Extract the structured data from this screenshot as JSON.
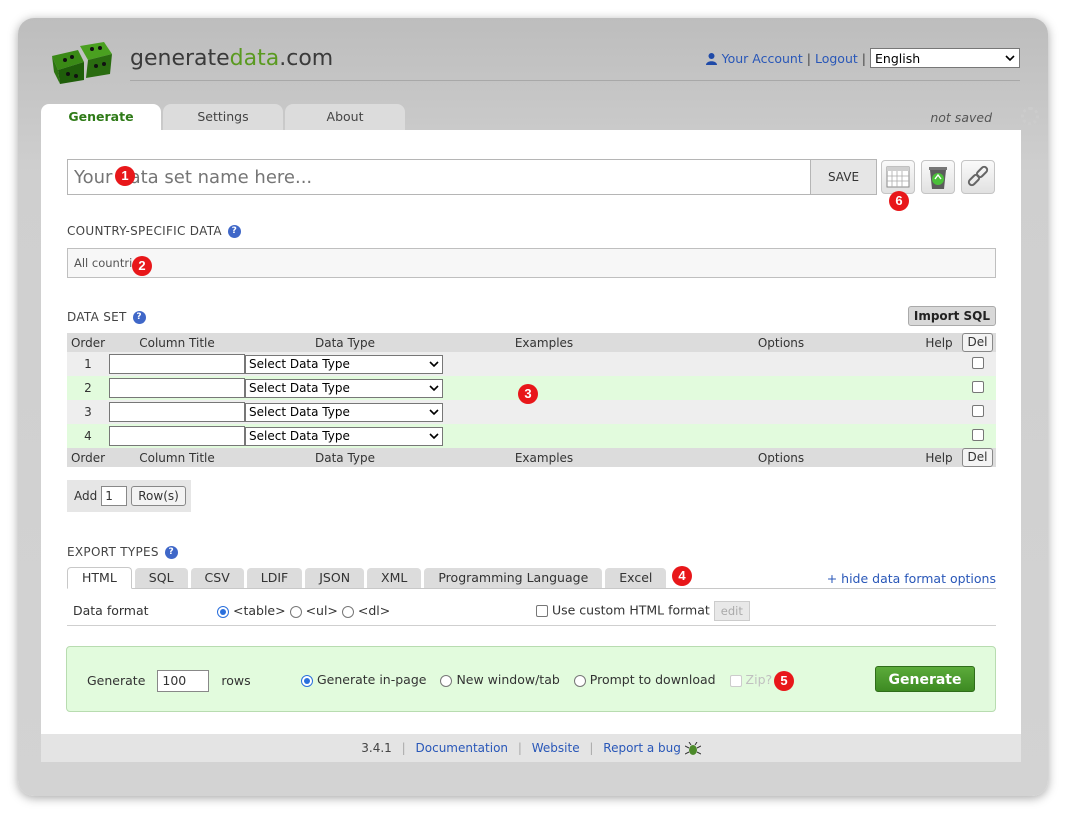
{
  "header": {
    "logo_text_1": "generate",
    "logo_text_2": "data",
    "logo_text_3": ".com",
    "account_label": "Your Account",
    "logout_label": "Logout",
    "separator": "|",
    "language": "English"
  },
  "tabs": [
    {
      "label": "Generate"
    },
    {
      "label": "Settings"
    },
    {
      "label": "About"
    }
  ],
  "save_status": "not saved",
  "dataset_name": {
    "placeholder": "Your data set name here...",
    "save_label": "SAVE"
  },
  "country": {
    "heading": "COUNTRY-SPECIFIC DATA",
    "value": "All countries"
  },
  "dataset": {
    "heading": "DATA SET",
    "import_label": "Import SQL",
    "columns": [
      "Order",
      "Column Title",
      "Data Type",
      "Examples",
      "Options",
      "Help",
      "Del"
    ],
    "rows": [
      {
        "order": "1",
        "type": "Select Data Type"
      },
      {
        "order": "2",
        "type": "Select Data Type"
      },
      {
        "order": "3",
        "type": "Select Data Type"
      },
      {
        "order": "4",
        "type": "Select Data Type"
      }
    ],
    "add_label": "Add",
    "add_count": "1",
    "rows_button": "Row(s)"
  },
  "export": {
    "heading": "EXPORT TYPES",
    "tabs": [
      "HTML",
      "SQL",
      "CSV",
      "LDIF",
      "JSON",
      "XML",
      "Programming Language",
      "Excel"
    ],
    "hide_link": "+ hide data format options",
    "format_label": "Data format",
    "format_options": [
      "<table>",
      "<ul>",
      "<dl>"
    ],
    "custom_label": "Use custom HTML format",
    "edit_label": "edit"
  },
  "generate": {
    "prefix": "Generate",
    "rows_value": "100",
    "suffix": "rows",
    "opt_inpage": "Generate in-page",
    "opt_newwin": "New window/tab",
    "opt_download": "Prompt to download",
    "zip_label": "Zip?",
    "button": "Generate"
  },
  "footer": {
    "version": "3.4.1",
    "docs": "Documentation",
    "website": "Website",
    "bug": "Report a bug"
  },
  "markers": [
    "1",
    "2",
    "3",
    "4",
    "5",
    "6"
  ],
  "colors": {
    "accent_green": "#5a9a20",
    "link_blue": "#2957b8",
    "marker_red": "#e8171a"
  }
}
